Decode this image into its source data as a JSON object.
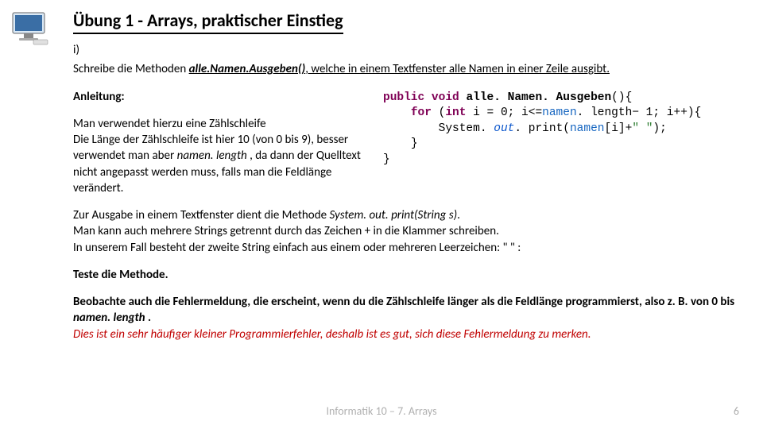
{
  "title": "Übung 1 - Arrays, praktischer Einstieg",
  "icon": "monitor-icon",
  "section_i": "i)",
  "schreibe_pre": "Schreibe die Methoden ",
  "schreibe_method": "alle.Namen.Ausgeben()",
  "schreibe_post": ", welche in einem Textfenster alle Namen in einer Zeile ausgibt.",
  "anleitung_label": "Anleitung:",
  "left_p1": "Man verwendet hierzu eine Zählschleife",
  "left_p2a": "Die Länge der Zählschleife ist hier 10 (von 0 bis 9), besser verwendet man aber ",
  "left_p2_ital": "namen. length",
  "left_p2b": " , da dann der Quelltext nicht angepasst werden muss, falls man die Feldlänge verändert.",
  "code": {
    "l1_kw1": "public",
    "l1_kw2": "void",
    "l1_meth": "alle. Namen. Ausgeben",
    "l1_tail": "(){",
    "l2_kw": "for",
    "l2_a": " (",
    "l2_int": "int",
    "l2_b": " i = 0; i<=",
    "l2_namen": "namen",
    "l2_c": ". length− 1; i++){",
    "l3_a": "System. ",
    "l3_out": "out",
    "l3_b": ". print(",
    "l3_namen": "namen",
    "l3_c": "[i]+",
    "l3_str": "\" \"",
    "l3_d": ");",
    "l4": "}",
    "l5": "}"
  },
  "zur_a": "Zur Ausgabe in einem Textfenster dient die Methode ",
  "zur_ital1": "System. out. print(String s)",
  "zur_b": ".",
  "zur_c": "Man kann auch mehrere Strings  getrennt durch das Zeichen +  in die Klammer schreiben.",
  "zur_d": "In unserem Fall besteht der zweite String einfach aus einem oder mehreren Leerzeichen:  \"  \" :",
  "teste": "Teste die Methode.",
  "beobachte_a": "Beobachte auch die Fehlermeldung, die erscheint, wenn du die Zählschleife länger als die Feldlänge programmierst, also z. B. von 0 bis ",
  "beobachte_ital": "namen. length",
  "beobachte_b": " .",
  "red": "Dies ist ein sehr häufiger kleiner Programmierfehler, deshalb ist es gut, sich diese Fehlermeldung zu merken.",
  "footer": "Informatik 10 – 7. Arrays",
  "page": "6"
}
